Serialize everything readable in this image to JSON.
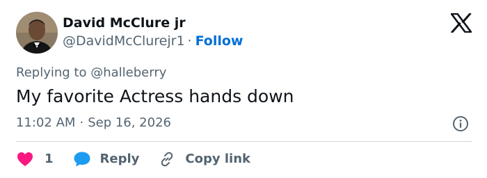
{
  "author": {
    "name": "David McClure jr",
    "handle": "@DavidMcClurejr1",
    "separator": "·",
    "follow_label": "Follow"
  },
  "reply_context": {
    "prefix": "Replying to",
    "mention": "@halleberry"
  },
  "tweet": {
    "text": "My favorite Actress hands down"
  },
  "timestamp": {
    "time": "11:02 AM",
    "separator": "·",
    "date": "Sep 16, 2026"
  },
  "actions": {
    "like_count": "1",
    "reply_label": "Reply",
    "copy_link_label": "Copy link"
  },
  "icons": {
    "brand": "x-logo-icon",
    "info": "info-icon",
    "like": "heart-icon",
    "reply": "speech-bubble-icon",
    "copy": "link-icon"
  },
  "colors": {
    "follow": "#006fd6",
    "secondary_text": "#536471",
    "primary_text": "#0f1419",
    "like": "#f91880",
    "reply": "#1d9bf0",
    "divider": "#cfd9de"
  }
}
